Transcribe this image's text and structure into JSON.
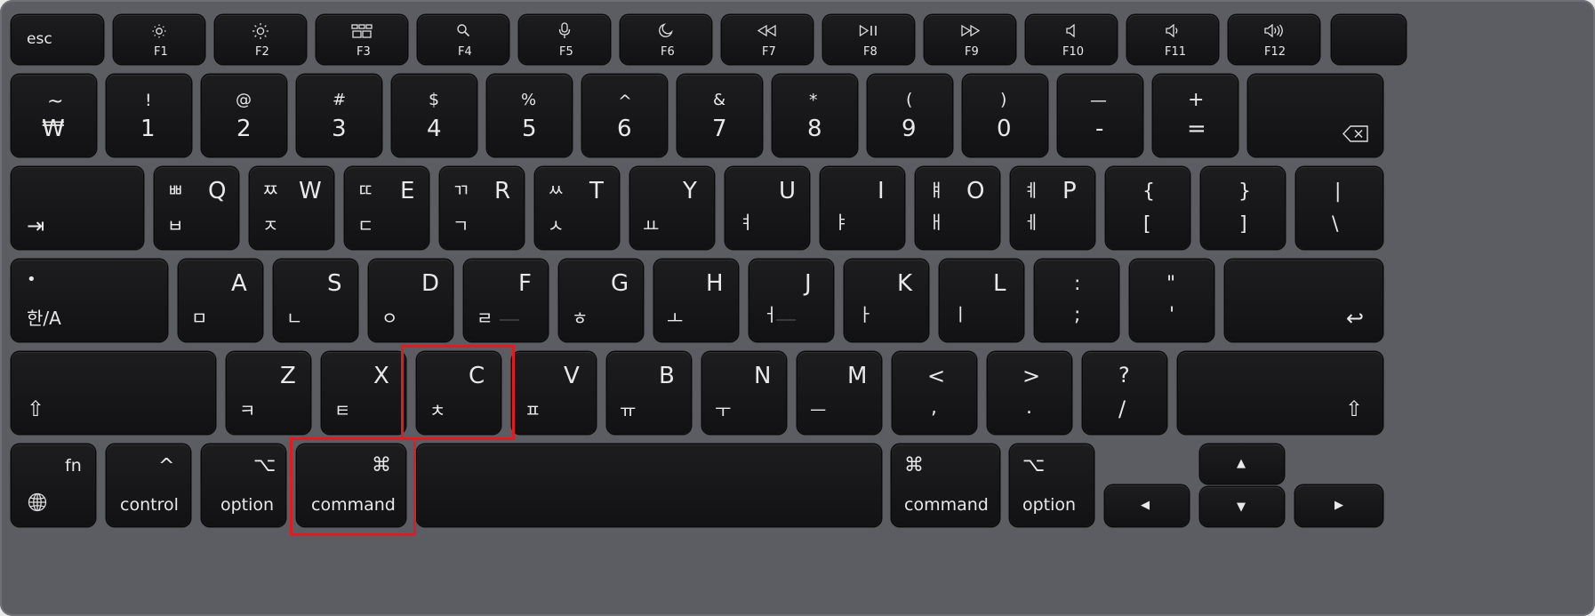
{
  "keyboard": {
    "row0": {
      "esc": "esc",
      "f1": "F1",
      "f2": "F2",
      "f3": "F3",
      "f4": "F4",
      "f5": "F5",
      "f6": "F6",
      "f7": "F7",
      "f8": "F8",
      "f9": "F9",
      "f10": "F10",
      "f11": "F11",
      "f12": "F12"
    },
    "row1": {
      "tilde": "~",
      "won": "₩",
      "k1u": "!",
      "k1": "1",
      "k2u": "@",
      "k2": "2",
      "k3u": "#",
      "k3": "3",
      "k4u": "$",
      "k4": "4",
      "k5u": "%",
      "k5": "5",
      "k6u": "^",
      "k6": "6",
      "k7u": "&",
      "k7": "7",
      "k8u": "*",
      "k8": "8",
      "k9u": "(",
      "k9": "9",
      "k0u": ")",
      "k0": "0",
      "minusu": "—",
      "minus": "-",
      "plus": "+",
      "equal": "="
    },
    "row2": {
      "tab": "⇥",
      "q_han_top": "ㅃ",
      "q": "Q",
      "q_han": "ㅂ",
      "w_han_top": "ㅉ",
      "w": "W",
      "w_han": "ㅈ",
      "e_han_top": "ㄸ",
      "e": "E",
      "e_han": "ㄷ",
      "r_han_top": "ㄲ",
      "r": "R",
      "r_han": "ㄱ",
      "t_han_top": "ㅆ",
      "t": "T",
      "t_han": "ㅅ",
      "y": "Y",
      "y_han": "ㅛ",
      "u": "U",
      "u_han": "ㅕ",
      "i": "I",
      "i_han": "ㅑ",
      "o_han_top": "ㅒ",
      "o": "O",
      "o_han": "ㅐ",
      "p_han_top": "ㅖ",
      "p": "P",
      "p_han": "ㅔ",
      "lbrace": "{",
      "lbracket": "[",
      "rbrace": "}",
      "rbracket": "]",
      "pipe": "|",
      "backslash": "\\"
    },
    "row3": {
      "caps_dot": "•",
      "caps": "한/A",
      "a": "A",
      "a_han": "ㅁ",
      "s": "S",
      "s_han": "ㄴ",
      "d": "D",
      "d_han": "ㅇ",
      "f": "F",
      "f_han": "ㄹ",
      "g": "G",
      "g_han": "ㅎ",
      "h": "H",
      "h_han": "ㅗ",
      "j": "J",
      "j_han": "ㅓ",
      "k": "K",
      "k_han": "ㅏ",
      "l": "L",
      "l_han": "ㅣ",
      "colon": ":",
      "semicolon": ";",
      "dquote": "\"",
      "squote": "'",
      "return": "↩"
    },
    "row4": {
      "shift": "⇧",
      "z": "Z",
      "z_han": "ㅋ",
      "x": "X",
      "x_han": "ㅌ",
      "c": "C",
      "c_han": "ㅊ",
      "v": "V",
      "v_han": "ㅍ",
      "b": "B",
      "b_han": "ㅠ",
      "n": "N",
      "n_han": "ㅜ",
      "m": "M",
      "m_han": "ㅡ",
      "lt": "<",
      "comma": ",",
      "gt": ">",
      "period": ".",
      "qmark": "?",
      "slash": "/",
      "rshift": "⇧"
    },
    "row5": {
      "fn": "fn",
      "globe": "🌐",
      "control_sym": "^",
      "control": "control",
      "option_sym": "⌥",
      "option": "option",
      "command_sym": "⌘",
      "command": "command",
      "rcommand_sym": "⌘",
      "rcommand": "command",
      "roption_sym": "⌥",
      "roption": "option",
      "up": "▲",
      "down": "▼",
      "left": "◀",
      "right": "▶"
    }
  },
  "highlight_color": "#e11b22",
  "icons": [
    "brightness-down-icon",
    "brightness-up-icon",
    "mission-control-icon",
    "search-icon",
    "microphone-icon",
    "moon-icon",
    "rewind-icon",
    "play-pause-icon",
    "fast-forward-icon",
    "mute-icon",
    "volume-down-icon",
    "volume-up-icon",
    "backspace-icon",
    "globe-icon"
  ]
}
